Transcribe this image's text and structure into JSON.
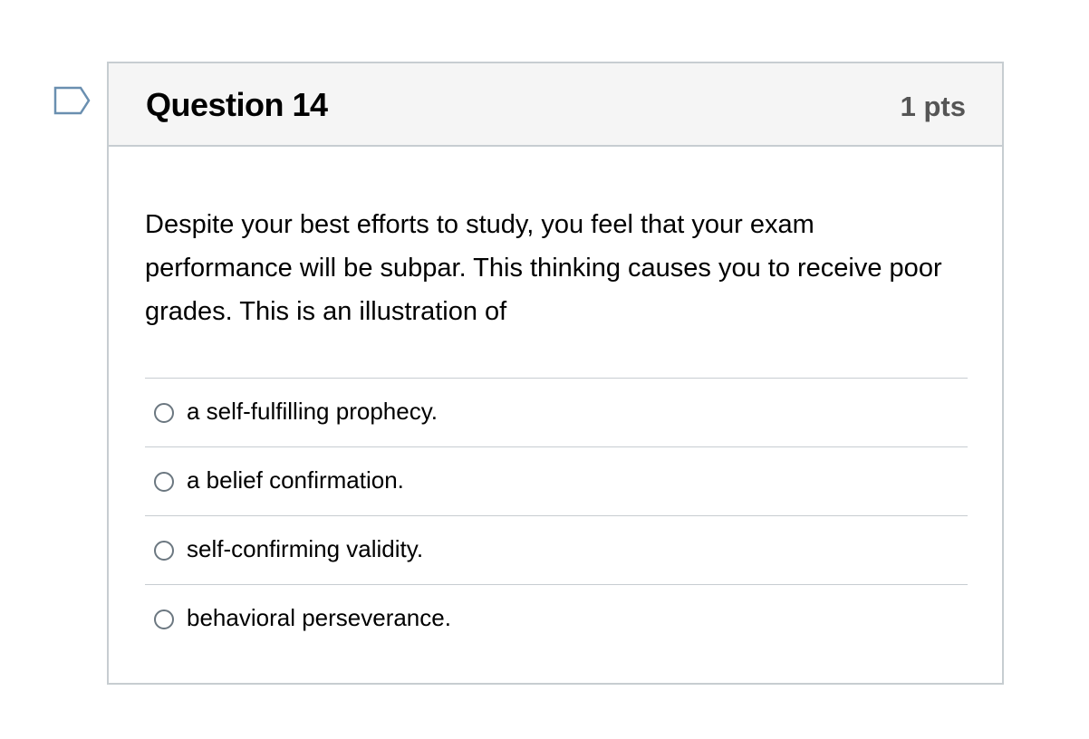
{
  "question": {
    "title": "Question 14",
    "points": "1 pts",
    "text": "Despite your best efforts to study, you feel that your exam performance will be subpar. This thinking causes you to receive poor grades. This is an illustration of",
    "flag_icon": "bookmark-flag-icon",
    "answers": [
      {
        "label": "a self-fulfilling prophecy."
      },
      {
        "label": "a belief confirmation."
      },
      {
        "label": "self-confirming validity."
      },
      {
        "label": "behavioral perseverance."
      }
    ]
  },
  "colors": {
    "border": "#c7cdd1",
    "header_bg": "#f5f5f5",
    "flag": "#6a8fb0",
    "points_text": "#555555"
  }
}
